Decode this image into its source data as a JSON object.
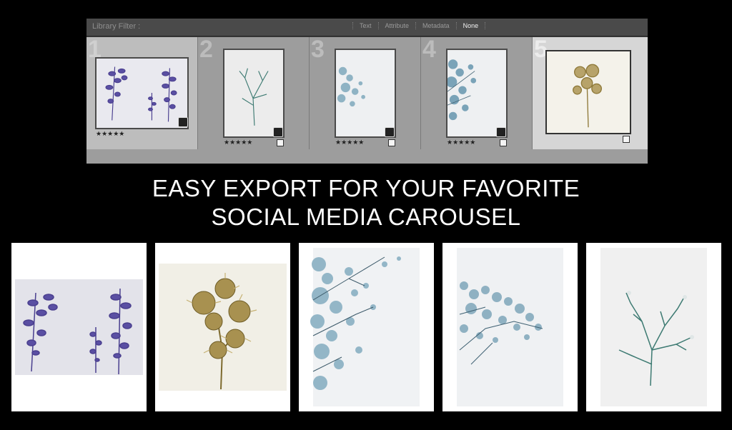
{
  "library_filter": {
    "title": "Library Filter :",
    "tabs": [
      "Text",
      "Attribute",
      "Metadata",
      "None"
    ],
    "active_tab": "None"
  },
  "grid": {
    "cells": [
      {
        "number": "1",
        "stars": "★★★★★",
        "state": "selected"
      },
      {
        "number": "2",
        "stars": "★★★★★",
        "state": "normal"
      },
      {
        "number": "3",
        "stars": "★★★★★",
        "state": "normal"
      },
      {
        "number": "4",
        "stars": "★★★★★",
        "state": "normal"
      },
      {
        "number": "5",
        "stars": "",
        "state": "highlight"
      }
    ]
  },
  "headline": {
    "line1": "EASY EXPORT FOR YOUR FAVORITE",
    "line2": "SOCIAL MEDIA CAROUSEL"
  },
  "colors": {
    "lavender": "#5a4fa3",
    "gold": "#8f7a3a",
    "teal": "#3d7a72",
    "frost": "#7aa3b8"
  }
}
